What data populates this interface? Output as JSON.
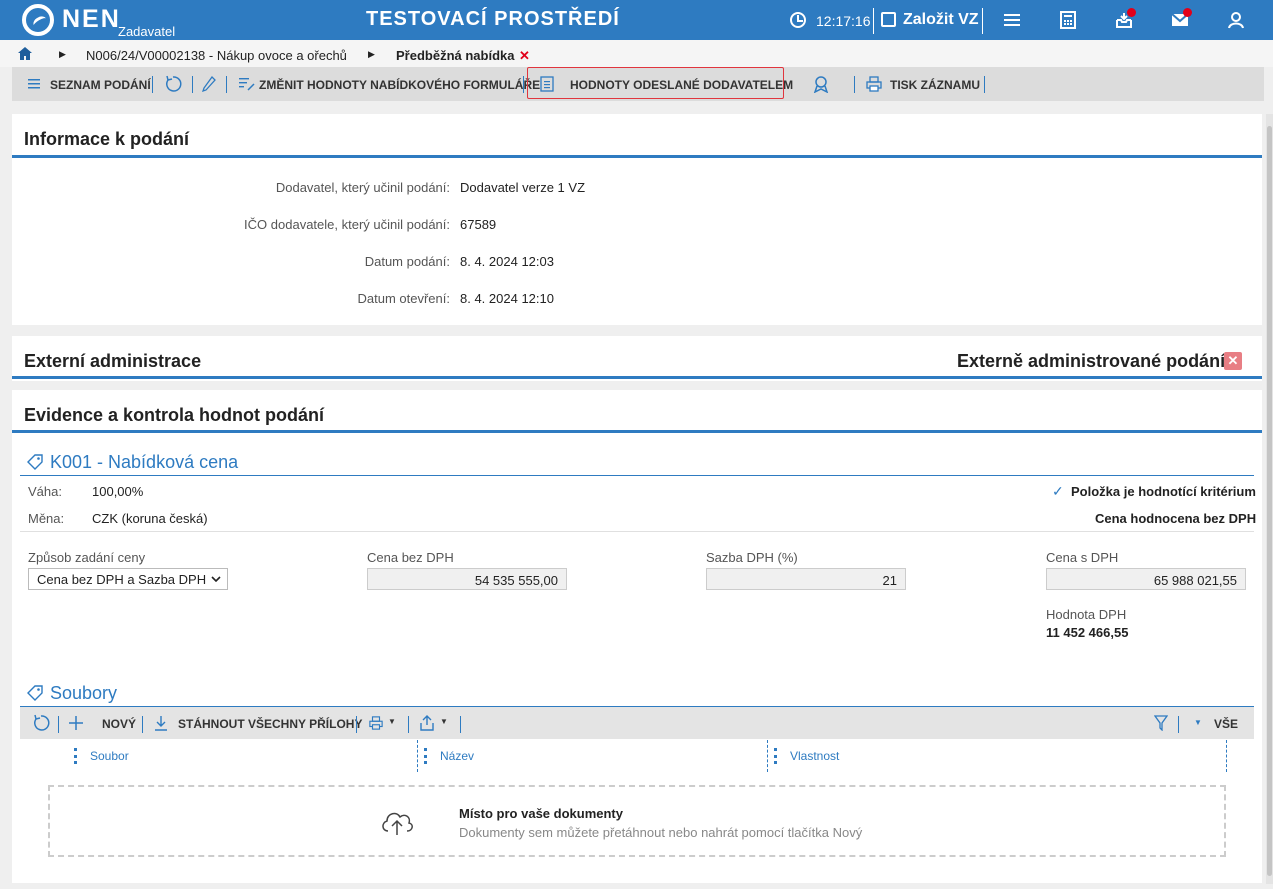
{
  "topbar": {
    "brand": "NEN",
    "role": "Zadavatel",
    "env_title": "TESTOVACÍ PROSTŘEDÍ",
    "time": "12:17:16",
    "new_vz": "Založit VZ"
  },
  "breadcrumb": {
    "item1": "N006/24/V00002138 - Nákup ovoce a ořechů",
    "item2": "Předběžná nabídka",
    "close": "✕"
  },
  "toolbar": {
    "list": "SEZNAM PODÁNÍ",
    "change": "ZMĚNIT HODNOTY NABÍDKOVÉHO FORMULÁŘE",
    "sent_values": "HODNOTY ODESLANÉ DODAVATELEM",
    "print": "TISK ZÁZNAMU"
  },
  "info": {
    "title": "Informace k podání",
    "rows": [
      {
        "label": "Dodavatel, který učinil podání:",
        "value": "Dodavatel verze 1 VZ"
      },
      {
        "label": "IČO dodavatele, který učinil podání:",
        "value": "67589"
      },
      {
        "label": "Datum podání:",
        "value": "8. 4. 2024 12:03"
      },
      {
        "label": "Datum otevření:",
        "value": "8. 4. 2024 12:10"
      }
    ]
  },
  "external": {
    "title": "Externí administrace",
    "flag_label": "Externě administrované podání:",
    "flag": "✕"
  },
  "evidence": {
    "title": "Evidence a kontrola hodnot podání",
    "criterion": {
      "title": "K001 - Nabídková cena",
      "weight_label": "Váha:",
      "weight": "100,00%",
      "currency_label": "Měna:",
      "currency": "CZK (koruna česká)",
      "is_criterion": "Položka je hodnotící kritérium",
      "price_note": "Cena hodnocena bez DPH"
    },
    "fields": {
      "mode_label": "Způsob zadání ceny",
      "mode_value": "Cena bez DPH a Sazba DPH",
      "price_label": "Cena bez DPH",
      "price_value": "54 535 555,00",
      "vat_rate_label": "Sazba DPH (%)",
      "vat_rate_value": "21",
      "price_vat_label": "Cena s DPH",
      "price_vat_value": "65 988 021,55",
      "vat_label": "Hodnota DPH",
      "vat_value": "11 452 466,55"
    }
  },
  "files": {
    "title": "Soubory",
    "new": "NOVÝ",
    "download_all": "STÁHNOUT VŠECHNY PŘÍLOHY",
    "all": "VŠE",
    "columns": [
      "Soubor",
      "Název",
      "Vlastnost"
    ],
    "drop_title": "Místo pro vaše dokumenty",
    "drop_hint": "Dokumenty sem můžete přetáhnout nebo nahrát pomocí tlačítka Nový"
  }
}
